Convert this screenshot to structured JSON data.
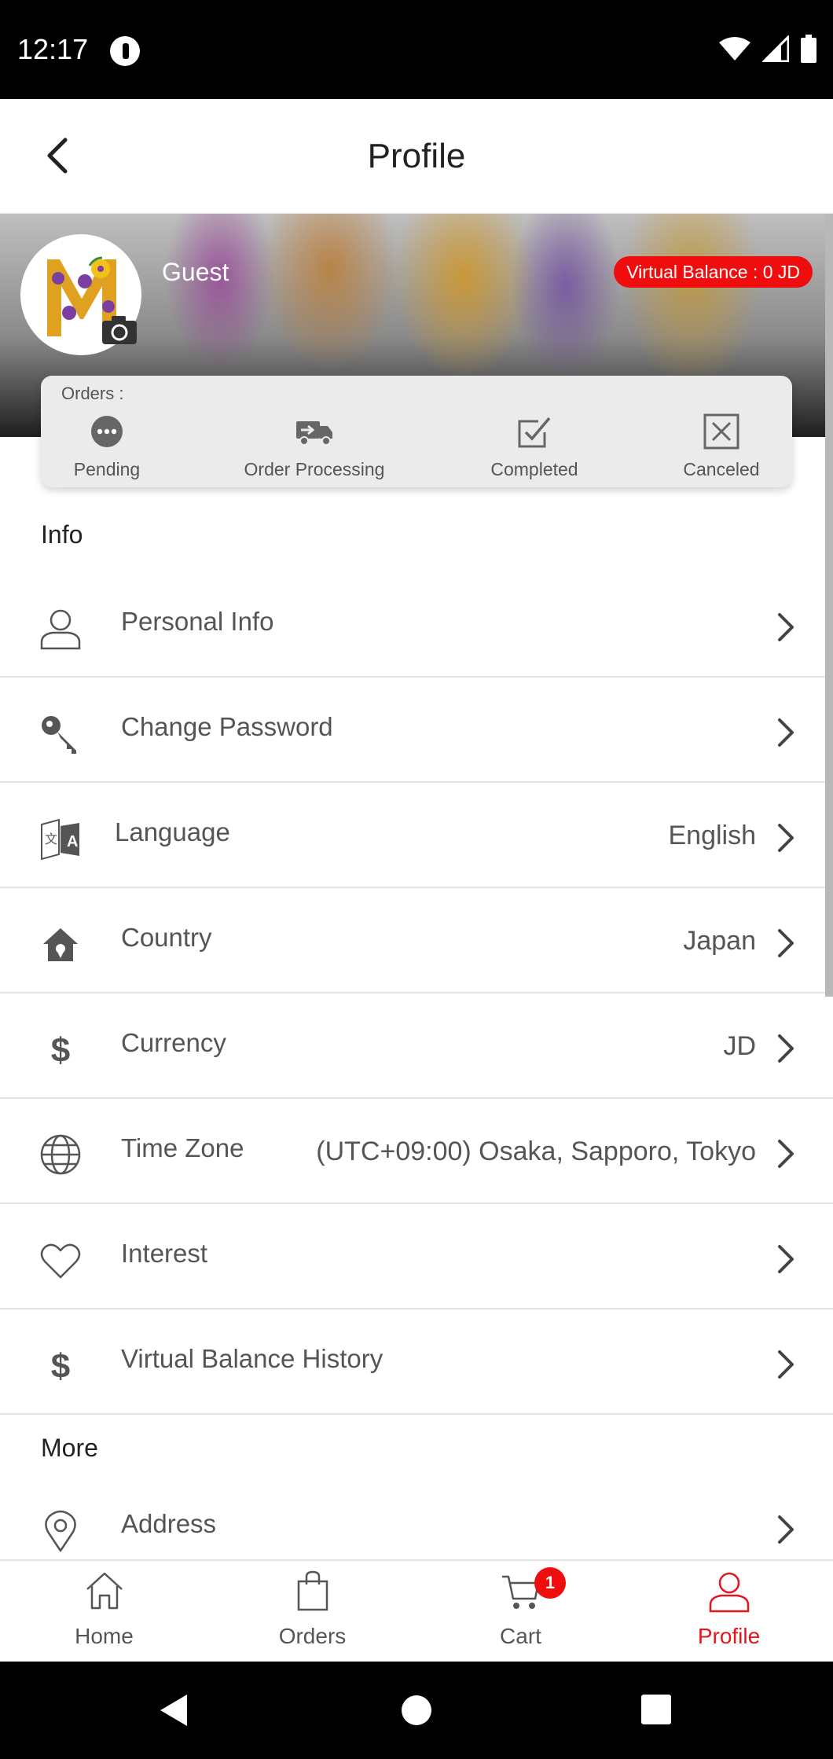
{
  "status_bar": {
    "time": "12:17"
  },
  "header": {
    "title": "Profile"
  },
  "profile": {
    "username": "Guest",
    "virtual_balance": "Virtual Balance : 0 JD"
  },
  "orders": {
    "label": "Orders :",
    "statuses": [
      {
        "label": "Pending",
        "icon": "pending-icon"
      },
      {
        "label": "Order Processing",
        "icon": "truck-icon"
      },
      {
        "label": "Completed",
        "icon": "checkbox-icon"
      },
      {
        "label": "Canceled",
        "icon": "cancel-box-icon"
      }
    ]
  },
  "info": {
    "title": "Info",
    "items": [
      {
        "label": "Personal Info",
        "value": "",
        "icon": "person-icon"
      },
      {
        "label": "Change Password",
        "value": "",
        "icon": "key-icon"
      },
      {
        "label": "Language",
        "value": "English",
        "icon": "translate-icon"
      },
      {
        "label": "Country",
        "value": "Japan",
        "icon": "home-location-icon"
      },
      {
        "label": "Currency",
        "value": "JD",
        "icon": "dollar-icon"
      },
      {
        "label": "Time Zone",
        "value": "(UTC+09:00) Osaka, Sapporo, Tokyo",
        "icon": "globe-icon"
      },
      {
        "label": "Interest",
        "value": "",
        "icon": "heart-icon"
      },
      {
        "label": "Virtual Balance History",
        "value": "",
        "icon": "dollar-icon"
      }
    ]
  },
  "more": {
    "title": "More",
    "items": [
      {
        "label": "Address",
        "icon": "location-pin-icon"
      }
    ]
  },
  "bottom_nav": {
    "items": [
      {
        "label": "Home",
        "icon": "home-icon"
      },
      {
        "label": "Orders",
        "icon": "bag-icon"
      },
      {
        "label": "Cart",
        "icon": "cart-icon",
        "badge": "1"
      },
      {
        "label": "Profile",
        "icon": "profile-icon",
        "active": true
      }
    ]
  },
  "colors": {
    "accent": "#e8141b",
    "badge": "#f00d0d",
    "text_muted": "#555555"
  }
}
